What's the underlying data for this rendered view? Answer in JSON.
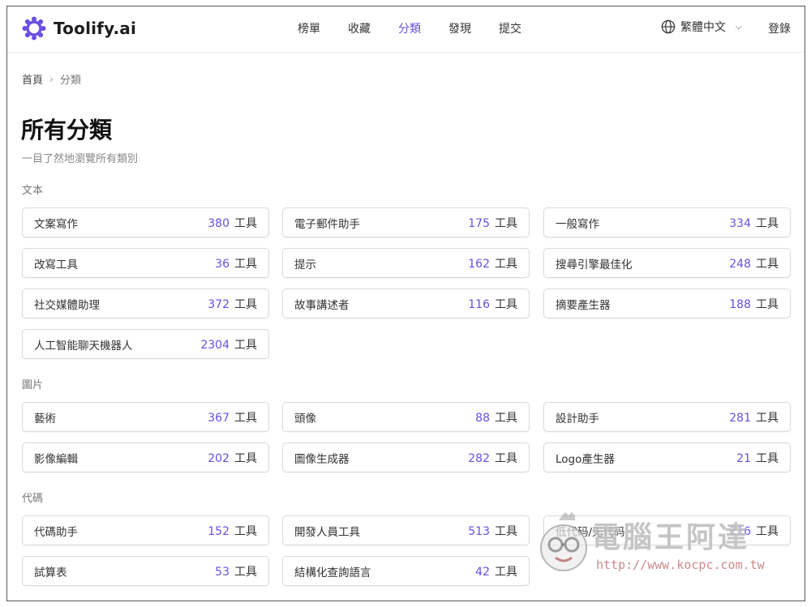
{
  "header": {
    "logo_text": "Toolify.ai",
    "nav": [
      {
        "label": "榜單",
        "active": false
      },
      {
        "label": "收藏",
        "active": false
      },
      {
        "label": "分類",
        "active": true
      },
      {
        "label": "發現",
        "active": false
      },
      {
        "label": "提交",
        "active": false
      }
    ],
    "language": "繁體中文",
    "login": "登錄"
  },
  "breadcrumb": {
    "home": "首頁",
    "current": "分類"
  },
  "page": {
    "title": "所有分類",
    "subtitle": "一目了然地瀏覽所有類別"
  },
  "unit_label": "工具",
  "sections": [
    {
      "label": "文本",
      "items": [
        {
          "name": "文案寫作",
          "count": "380"
        },
        {
          "name": "電子郵件助手",
          "count": "175"
        },
        {
          "name": "一般寫作",
          "count": "334"
        },
        {
          "name": "改寫工具",
          "count": "36"
        },
        {
          "name": "提示",
          "count": "162"
        },
        {
          "name": "搜尋引擎最佳化",
          "count": "248"
        },
        {
          "name": "社交媒體助理",
          "count": "372"
        },
        {
          "name": "故事講述者",
          "count": "116"
        },
        {
          "name": "摘要產生器",
          "count": "188"
        },
        {
          "name": "人工智能聊天機器人",
          "count": "2304"
        }
      ]
    },
    {
      "label": "圖片",
      "items": [
        {
          "name": "藝術",
          "count": "367"
        },
        {
          "name": "頭像",
          "count": "88"
        },
        {
          "name": "設計助手",
          "count": "281"
        },
        {
          "name": "影像編輯",
          "count": "202"
        },
        {
          "name": "圖像生成器",
          "count": "282"
        },
        {
          "name": "Logo產生器",
          "count": "21"
        }
      ]
    },
    {
      "label": "代碼",
      "items": [
        {
          "name": "代碼助手",
          "count": "152"
        },
        {
          "name": "開發人員工具",
          "count": "513"
        },
        {
          "name": "低代码/无代码",
          "count": "216"
        },
        {
          "name": "試算表",
          "count": "53"
        },
        {
          "name": "結構化查詢語言",
          "count": "42"
        }
      ]
    }
  ],
  "watermark": {
    "title": "電腦王阿達",
    "url": "http://www.kocpc.com.tw"
  },
  "colors": {
    "accent": "#6a4fe0",
    "border": "#d9d9df",
    "muted": "#888888"
  }
}
